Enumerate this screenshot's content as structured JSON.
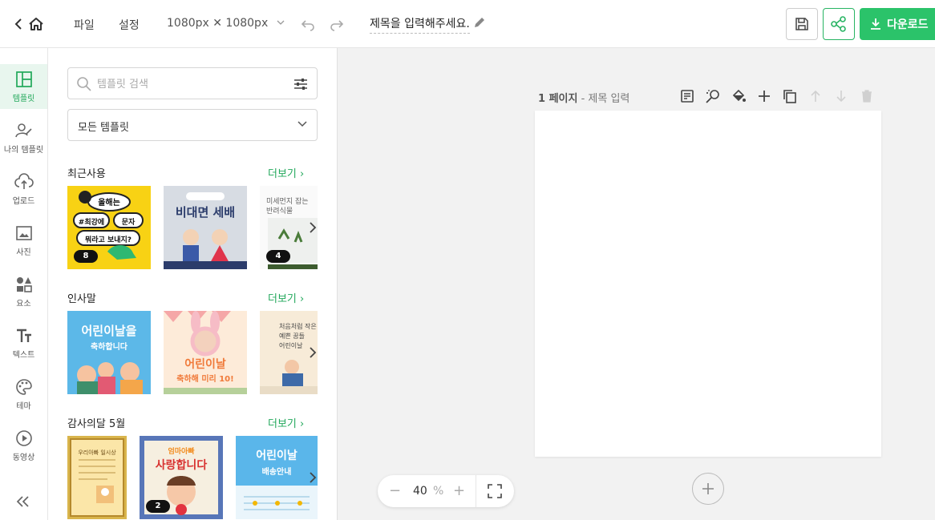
{
  "topbar": {
    "menu_file": "파일",
    "menu_settings": "설정",
    "canvas_size": "1080px ✕ 1080px",
    "doc_title": "제목을 입력해주세요.",
    "download_label": "다운로드"
  },
  "rail": {
    "items": [
      {
        "label": "템플릿"
      },
      {
        "label": "나의 템플릿"
      },
      {
        "label": "업로드"
      },
      {
        "label": "사진"
      },
      {
        "label": "요소"
      },
      {
        "label": "텍스트"
      },
      {
        "label": "테마"
      },
      {
        "label": "동영상"
      }
    ]
  },
  "panel": {
    "search_placeholder": "템플릿 검색",
    "filter_value": "모든 템플릿",
    "more_label": "더보기",
    "sections": [
      {
        "title": "최근사용",
        "thumbs": [
          {
            "lines": [
              "올해는",
              "#최강에",
              "문자",
              "뭐라고 보내지?"
            ],
            "badge": "8"
          },
          {
            "lines": [
              "비대면 세배"
            ],
            "badge": ""
          },
          {
            "lines": [
              "미세먼지 잡는",
              "반려식물"
            ],
            "badge": "4"
          }
        ]
      },
      {
        "title": "인사말",
        "thumbs": [
          {
            "lines": [
              "어린이날을",
              "축하합니다"
            ],
            "badge": ""
          },
          {
            "lines": [
              "어린이날",
              "축하해 미리 10!"
            ],
            "badge": ""
          },
          {
            "lines": [
              "처음처럼 작은",
              "예쁜 꿈들",
              "어린이날"
            ],
            "badge": ""
          }
        ]
      },
      {
        "title": "감사의달 5월",
        "thumbs": [
          {
            "lines": [
              "우리아빠 일시상"
            ],
            "badge": ""
          },
          {
            "lines": [
              "엄마아빠",
              "사랑합니다"
            ],
            "badge": "2"
          },
          {
            "lines": [
              "어린이날",
              "배송안내"
            ],
            "badge": ""
          }
        ]
      }
    ]
  },
  "canvas": {
    "page_number": "1 페이지",
    "page_title_separator": " - ",
    "page_title_placeholder": "제목 입력",
    "zoom_value": "40",
    "zoom_unit": "%"
  },
  "colors": {
    "accent": "#22a85b",
    "download_bg": "#2bc36a"
  }
}
